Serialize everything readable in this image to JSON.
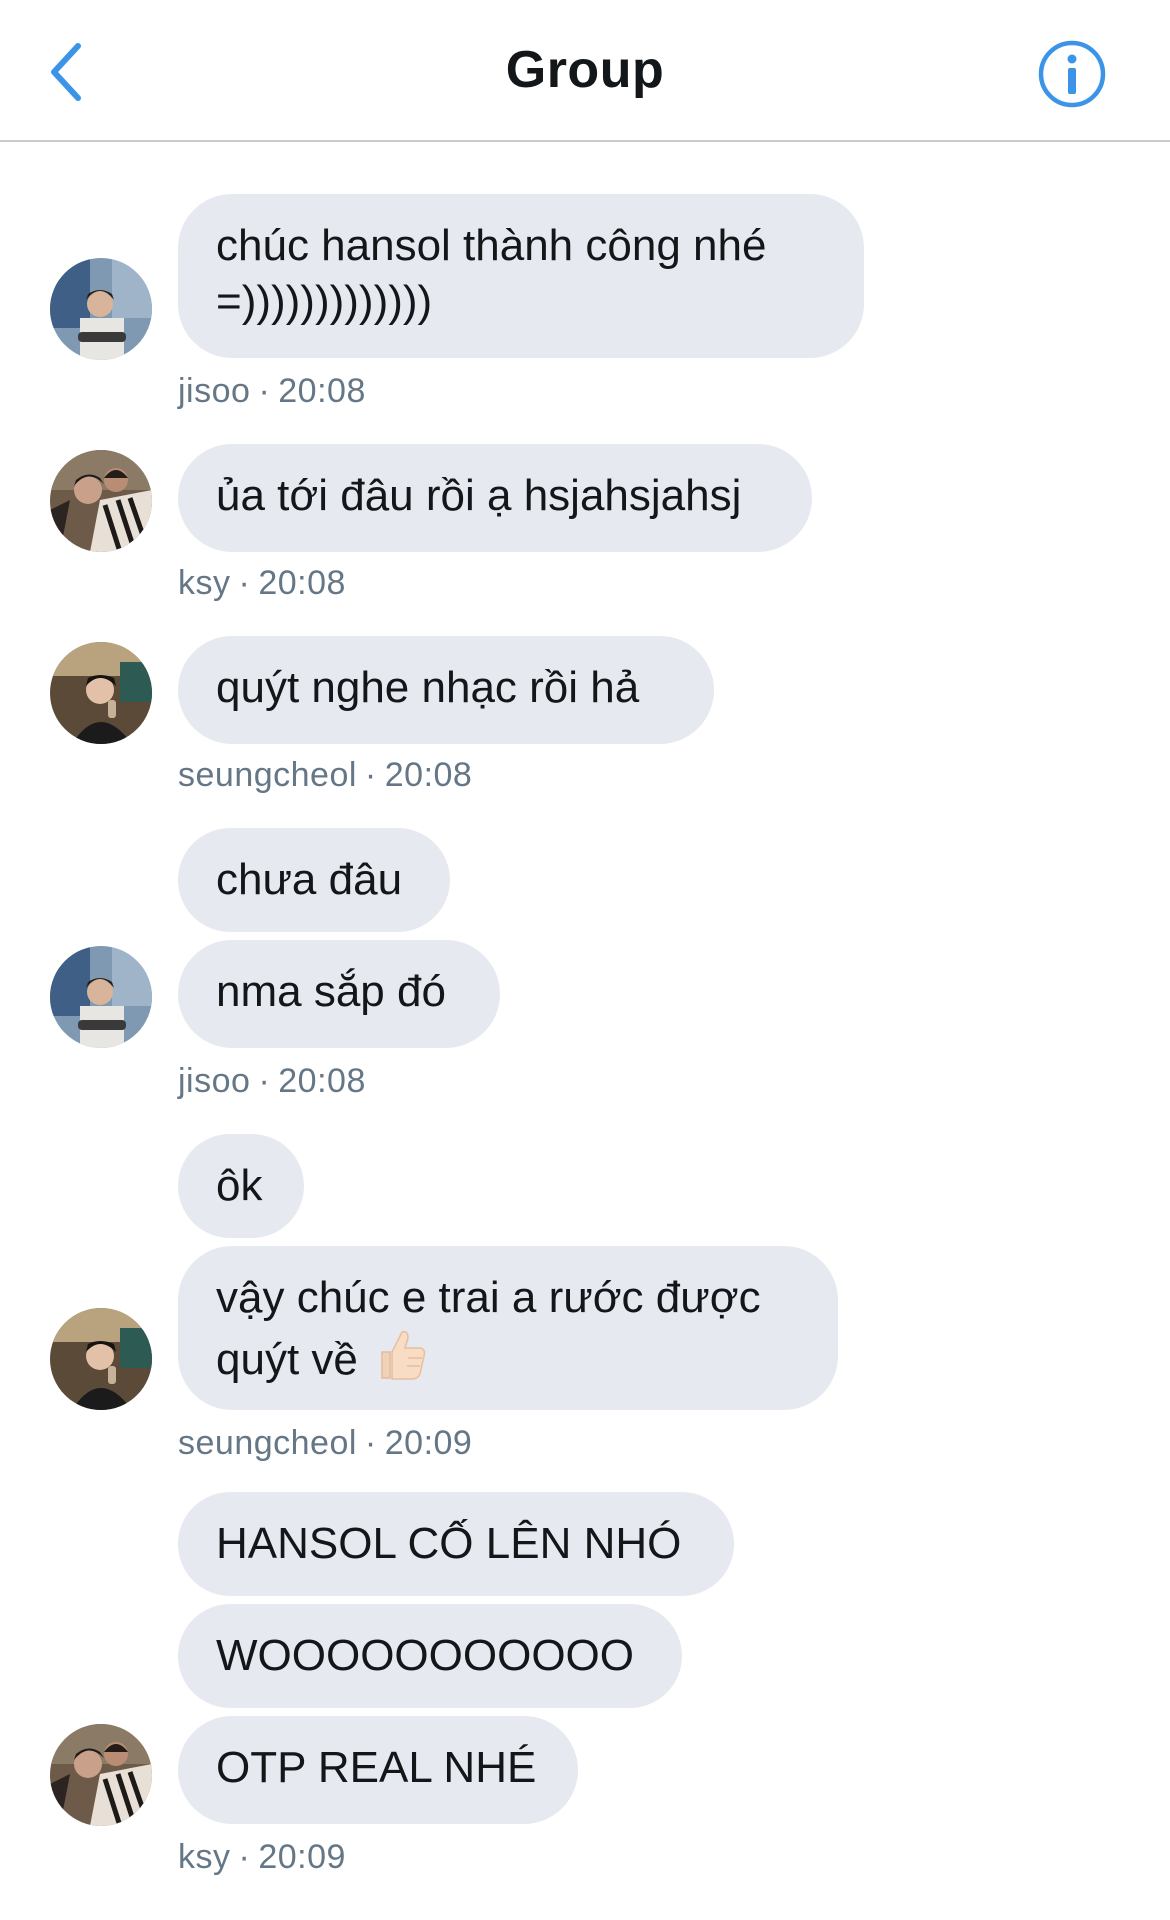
{
  "header": {
    "title": "Group",
    "back_icon": "chevron-left-icon",
    "info_icon": "info-icon"
  },
  "colors": {
    "accent": "#3b94e6",
    "bubble": "#e6e9ef",
    "meta_text": "#657786"
  },
  "messages": [
    {
      "sender": "jisoo",
      "time": "20:08",
      "bubbles": [
        "chúc hansol thành công nhé",
        "=)))))))))))))"
      ]
    },
    {
      "sender": "ksy",
      "time": "20:08",
      "bubbles": [
        "ủa tới đâu rồi ạ hsjahsjahsj"
      ]
    },
    {
      "sender": "seungcheol",
      "time": "20:08",
      "bubbles": [
        "quýt nghe nhạc rồi hả"
      ]
    },
    {
      "sender": "jisoo",
      "time": "20:08",
      "bubbles": [
        "chưa đâu",
        "nma sắp đó"
      ]
    },
    {
      "sender": "seungcheol",
      "time": "20:09",
      "bubbles": [
        "ôk",
        "vậy chúc e trai a rước được",
        "quýt về"
      ],
      "emoji": "thumbs-up-icon"
    },
    {
      "sender": "ksy",
      "time": "20:09",
      "bubbles": [
        "HANSOL CỐ LÊN NHÓ",
        "WOOOOOOOOOOO",
        "OTP REAL NHÉ"
      ]
    }
  ],
  "separator": "·"
}
